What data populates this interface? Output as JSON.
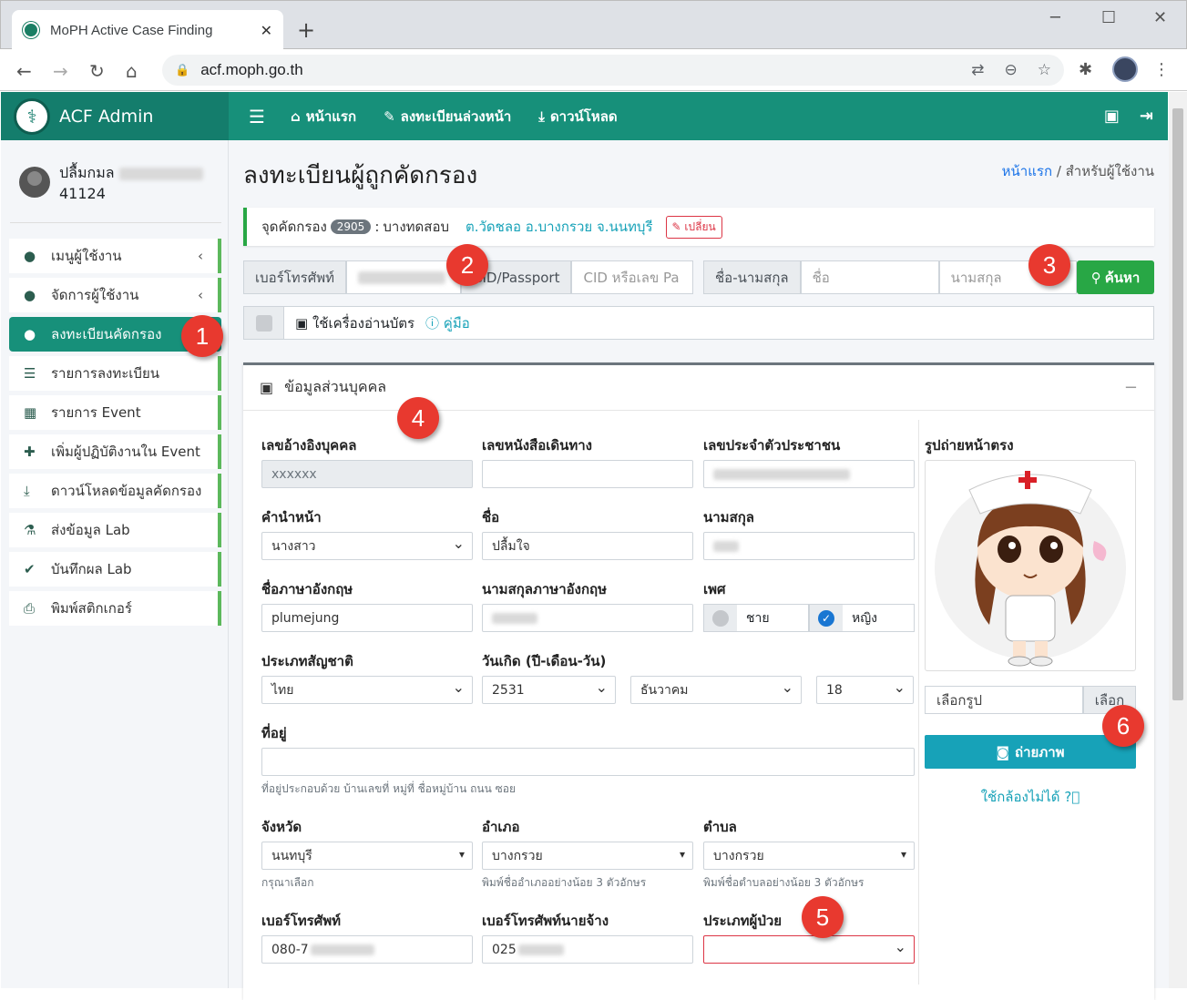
{
  "browser": {
    "tab_title": "MoPH Active Case Finding",
    "url": "acf.moph.go.th"
  },
  "brand": "ACF Admin",
  "topnav": [
    {
      "label": "หน้าแรก",
      "icon": "home-icon"
    },
    {
      "label": "ลงทะเบียนล่วงหน้า",
      "icon": "pencil-icon"
    },
    {
      "label": "ดาวน์โหลด",
      "icon": "download-icon"
    }
  ],
  "user": {
    "name": "ปลื้มกมล",
    "id": "41124"
  },
  "sidebar": [
    {
      "label": "เมนูผู้ใช้งาน",
      "icon": "user-icon",
      "chevron": true
    },
    {
      "label": "จัดการผู้ใช้งาน",
      "icon": "user-cog-icon",
      "chevron": true
    },
    {
      "label": "ลงทะเบียนคัดกรอง",
      "icon": "user-edit-icon",
      "active": true
    },
    {
      "label": "รายการลงทะเบียน",
      "icon": "list-icon"
    },
    {
      "label": "รายการ Event",
      "icon": "calendar-icon"
    },
    {
      "label": "เพิ่มผู้ปฏิบัติงานใน Event",
      "icon": "user-plus-icon"
    },
    {
      "label": "ดาวน์โหลดข้อมูลคัดกรอง",
      "icon": "download-icon"
    },
    {
      "label": "ส่งข้อมูล Lab",
      "icon": "lab-icon"
    },
    {
      "label": "บันทึกผล Lab",
      "icon": "clipboard-icon"
    },
    {
      "label": "พิมพ์สติกเกอร์",
      "icon": "printer-icon"
    }
  ],
  "page": {
    "title": "ลงทะเบียนผู้ถูกคัดกรอง",
    "crumb_home": "หน้าแรก",
    "crumb_sep": "/",
    "crumb_current": "สำหรับผู้ใช้งาน"
  },
  "alert": {
    "label": "จุดคัดกรอง",
    "badge": "2905",
    "sep": ":",
    "name": "บางทดสอบ",
    "location": "ต.วัดชลอ อ.บางกรวย จ.นนทบุรี",
    "change": "เปลี่ยน"
  },
  "search": {
    "phone_label": "เบอร์โทรศัพท์",
    "cid_label": "CID/Passport",
    "cid_placeholder": "CID หรือเลข Pa",
    "name_label": "ชื่อ-นามสกุล",
    "first_placeholder": "ชื่อ",
    "last_placeholder": "นามสกุล",
    "button": "ค้นหา"
  },
  "reader": {
    "label": "ใช้เครื่องอ่านบัตร",
    "help": "คู่มือ"
  },
  "card": {
    "title": "ข้อมูลส่วนบุคคล",
    "minimize": "−"
  },
  "form": {
    "ref_label": "เลขอ้างอิงบุคคล",
    "ref_value": "xxxxxx",
    "passport_label": "เลขหนังสือเดินทาง",
    "passport_value": "",
    "cid_label": "เลขประจำตัวประชาชน",
    "prefix_label": "คำนำหน้า",
    "prefix_value": "นางสาว",
    "fname_label": "ชื่อ",
    "fname_value": "ปลื้มใจ",
    "lname_label": "นามสกุล",
    "efname_label": "ชื่อภาษาอังกฤษ",
    "efname_value": "plumejung",
    "elname_label": "นามสกุลภาษาอังกฤษ",
    "sex_label": "เพศ",
    "male": "ชาย",
    "female": "หญิง",
    "nat_label": "ประเภทสัญชาติ",
    "nat_value": "ไทย",
    "dob_label": "วันเกิด (ปี-เดือน-วัน)",
    "year": "2531",
    "month": "ธันวาคม",
    "day": "18",
    "addr_label": "ที่อยู่",
    "addr_help": "ที่อยู่ประกอบด้วย บ้านเลขที่ หมู่ที่ ชื่อหมู่บ้าน ถนน ซอย",
    "prov_label": "จังหวัด",
    "prov_value": "นนทบุรี",
    "prov_help": "กรุณาเลือก",
    "amp_label": "อำเภอ",
    "amp_value": "บางกรวย",
    "amp_help": "พิมพ์ชื่ออำเภออย่างน้อย 3 ตัวอักษร",
    "tam_label": "ตำบล",
    "tam_value": "บางกรวย",
    "tam_help": "พิมพ์ชื่อตำบลอย่างน้อย 3 ตัวอักษร",
    "phone_label": "เบอร์โทรศัพท์",
    "phone_value": "080-7",
    "ephone_label": "เบอร์โทรศัพท์นายจ้าง",
    "ephone_value": "025",
    "ptype_label": "ประเภทผู้ป่วย",
    "photo_label": "รูปถ่ายหน้าตรง",
    "pick": "เลือกรูป",
    "pick_btn": "เลือก",
    "snap": "ถ่ายภาพ",
    "nocam": "ใช้กล้องไม่ได้"
  },
  "markers": [
    "1",
    "2",
    "3",
    "4",
    "5",
    "6"
  ]
}
